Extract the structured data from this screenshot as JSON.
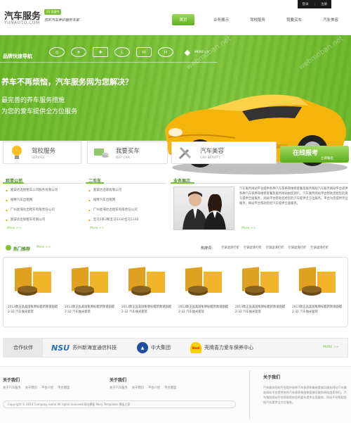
{
  "header": {
    "logo_title": "汽车服务",
    "logo_badge": "23 发展中",
    "logo_sub": "YUNAUTO.COM",
    "slogan": "您的汽车养护服务专家",
    "top_links": [
      "登录",
      "注册"
    ],
    "nav": [
      "首页",
      "业务展示",
      "驾校服务",
      "我要买车",
      "汽车美容"
    ]
  },
  "banner": {
    "brand_nav_label": "品牌快速导航",
    "brand_logos": [
      "toyota-logo",
      "mercedes-logo",
      "chevrolet-logo",
      "lexus-logo",
      "honda-logo",
      "hyundai-logo",
      "mitsubishi-logo"
    ],
    "brand_more": "MORE>>",
    "headline": "养车不再烦恼，汽车服务网为您解决？",
    "sub1": "最完善的养车服务措施",
    "sub2": "为您的爱车提供全方位服务"
  },
  "services": [
    {
      "title": "驾校服务",
      "sub": "SERVICE",
      "icon": "bulb-icon"
    },
    {
      "title": "我要买车",
      "sub": "BUY CAR",
      "icon": "coins-icon"
    },
    {
      "title": "汽车美容",
      "sub": "CAR BEAUTY",
      "icon": "tools-icon"
    }
  ],
  "apply": {
    "main": "在线报考",
    "sub": "立即报名"
  },
  "rental": {
    "title": "租赁公司",
    "items": [
      "富安达连锁租车公司服务有限公司",
      "福特汽车出租网",
      "广州星海达出租车有限责任公司",
      "富安达连锁租车有限公司"
    ],
    "more": "More >>"
  },
  "used": {
    "title": "二手车",
    "items": [
      "富安达连锁有限公司",
      "福特汽车出租网",
      "广州星海达出租车有限责任公司",
      "宝马5系3和宝马5330宝马5330"
    ],
    "more": "More >>"
  },
  "business": {
    "title": "业务展示",
    "text": "汽车服务网站平台提供各种汽车保养和维修套餐及服务网站汽车服务网站平台提供各种汽车保养和维修套餐及服务网站由您领行。汽车服务网站平台帮助您给您的爱车提供全面服务，网站平台帮助您给您的汽车提供全方位服务。平台为您提供专业服务，网站平台帮助您给汽车提供全面服务。",
    "more": "More >>"
  },
  "hot": {
    "title": "热门推荐",
    "more": "More >>",
    "tag_label": "热搜词：",
    "tags": [
      "空调滤清打折",
      "空调滤清打折",
      "空调滤清打折",
      "空调滤清打折",
      "空调滤清打折"
    ],
    "products": [
      "2013款正品美国龟牌标蜡新款镜面蜡 2-32 汽车抛光套装",
      "2013款正品美国龟牌标蜡新款镜面蜡 2-32 汽车抛光套装",
      "2013款正品美国龟牌标蜡新款镜面蜡 2-32 汽车抛光套装",
      "2013款正品美国龟牌标蜡新款镜面蜡 2-32 汽车抛光套装",
      "2013款正品美国龟牌标蜡新款镜面蜡 2-32 汽车抛光套装",
      "2013款正品美国龟牌标蜡新款镜面蜡 2-32 汽车抛光套装"
    ]
  },
  "partners": {
    "label": "合作伙伴",
    "items": [
      {
        "logo": "NSU",
        "name": "苏州新海宜通信科技"
      },
      {
        "logo": "中大",
        "name": "中大集团"
      },
      {
        "logo": "Shell",
        "name": "壳牌喜力爱车保养中心"
      }
    ],
    "more": "MORE >>"
  },
  "footer": {
    "col1_title": "关于我们",
    "col1_links": [
      "关于汽车服务",
      "关于我们",
      "平台介绍",
      "平台图鉴"
    ],
    "col2_title": "关于我们",
    "col2_links": [
      "关于汽车服务",
      "关于我们",
      "平台介绍",
      "平台图鉴"
    ],
    "copyright": "Copyright © 2014 Company name All rights reserved 网站模板    Mory Templates 模板之家",
    "about_title": "关于我们",
    "about_text": "汽车服务网站平台提供各种汽车保养和维修套餐及服务网站汽车服务网站平台提供各种汽车保养和维修套餐及服务网站由您领行。汽车服务网站平台帮助您给您的爱车提供全面服务，网站平台帮助您给汽车提供全方位服务。"
  }
}
